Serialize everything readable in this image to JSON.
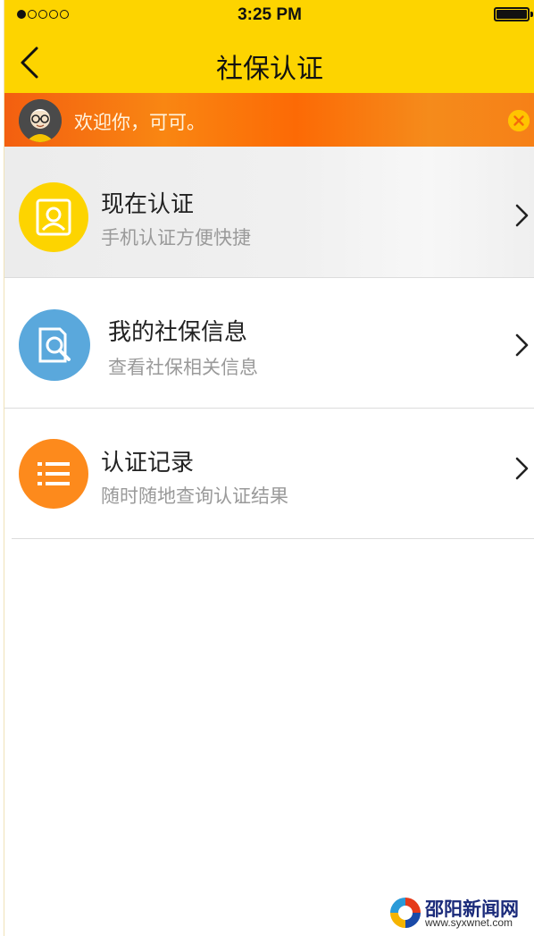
{
  "status_bar": {
    "time": "3:25 PM",
    "signal_filled": 1,
    "signal_total": 5
  },
  "nav": {
    "title": "社保认证",
    "back_icon": "chevron-left-icon"
  },
  "banner": {
    "text": "欢迎你，可可。",
    "close_icon": "close-circle-icon",
    "colors": {
      "from": "#f35f10",
      "to": "#f68017"
    }
  },
  "menu": {
    "items": [
      {
        "title": "现在认证",
        "subtitle": "手机认证方便快捷",
        "icon": "id-card-icon",
        "icon_color": "#fdd400"
      },
      {
        "title": "我的社保信息",
        "subtitle": "查看社保相关信息",
        "icon": "document-search-icon",
        "icon_color": "#5aa8dc"
      },
      {
        "title": "认证记录",
        "subtitle": "随时随地查询认证结果",
        "icon": "list-icon",
        "icon_color": "#fd8a1c"
      }
    ]
  },
  "watermark": {
    "name": "邵阳新闻网",
    "url": "www.syxwnet.com"
  },
  "colors": {
    "accent": "#fdd400"
  }
}
